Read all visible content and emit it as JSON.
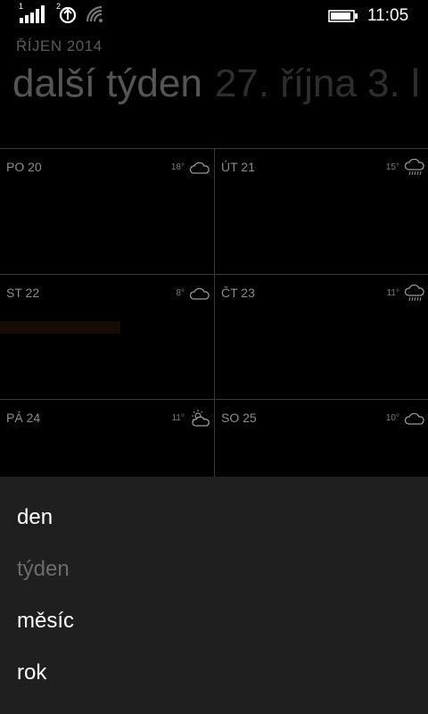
{
  "status_bar": {
    "sim1": "1",
    "sim2": "2",
    "time": "11:05",
    "icons": [
      "signal-strength-icon",
      "data-connection-icon",
      "wifi-icon",
      "battery-icon"
    ]
  },
  "header": {
    "month": "ŘÍJEN 2014",
    "pivot_active": "další týden",
    "pivot_next": "27. října 3. l"
  },
  "days": [
    {
      "label": "PO 20",
      "temp": "18°",
      "icon": "cloud-icon"
    },
    {
      "label": "ÚT 21",
      "temp": "15°",
      "icon": "cloud-rain-icon"
    },
    {
      "label": "ST 22",
      "temp": "8°",
      "icon": "cloud-icon"
    },
    {
      "label": "ČT 23",
      "temp": "11°",
      "icon": "cloud-rain-icon"
    },
    {
      "label": "PÁ 24",
      "temp": "11°",
      "icon": "partly-sunny-icon"
    },
    {
      "label": "SO 25",
      "temp": "10°",
      "icon": "cloud-icon"
    }
  ],
  "menu": {
    "items": [
      {
        "label": "den",
        "selected": false
      },
      {
        "label": "týden",
        "selected": true
      },
      {
        "label": "měsíc",
        "selected": false
      },
      {
        "label": "rok",
        "selected": false
      }
    ]
  },
  "colors": {
    "background": "#000000",
    "menu_background": "#1f1f1f",
    "grid_line": "#3b3b3b",
    "event_bar": "#170b06"
  }
}
